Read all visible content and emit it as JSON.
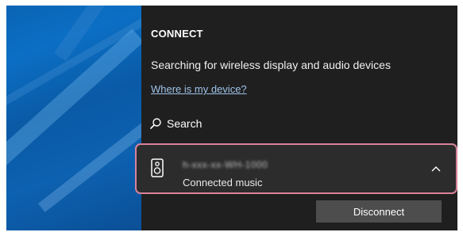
{
  "panel": {
    "title": "CONNECT",
    "status": "Searching for wireless display and audio devices",
    "help_link": "Where is my device?",
    "search_label": "Search"
  },
  "device": {
    "name": "h-xxx-xx-WH-1000",
    "status": "Connected music",
    "icon": "speaker-icon",
    "expand_icon": "chevron-up-icon",
    "highlight_color": "#d9839a"
  },
  "actions": {
    "disconnect_label": "Disconnect"
  },
  "colors": {
    "panel_bg": "#1f1f1f",
    "wallpaper": "#0b6fc4",
    "link": "#9ec3ea",
    "button_bg": "#4d4d4d"
  }
}
